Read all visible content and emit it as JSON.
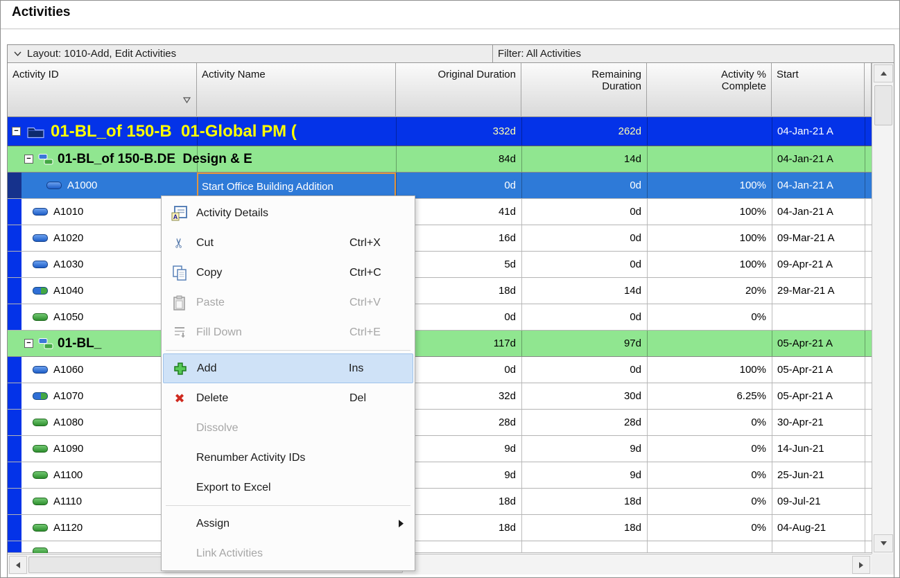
{
  "page": {
    "title": "Activities"
  },
  "toolbar": {
    "layout_label": "Layout: 1010-Add, Edit Activities",
    "filter_label": "Filter: All Activities"
  },
  "table": {
    "columns": [
      "Activity ID",
      "Activity Name",
      "Original Duration",
      "Remaining Duration",
      "Activity % Complete",
      "Start"
    ],
    "rows": [
      {
        "type": "wbs1",
        "name": "01-BL_of 150-B  01-Global PM (",
        "od": "332d",
        "rd": "262d",
        "pct": "",
        "start": "04-Jan-21 A"
      },
      {
        "type": "wbs2",
        "name": "01-BL_of 150-B.DE  Design & E",
        "od": "84d",
        "rd": "14d",
        "pct": "",
        "start": "04-Jan-21 A"
      },
      {
        "type": "activity",
        "selected": true,
        "status": "completed",
        "id": "A1000",
        "name": "Start Office Building Addition",
        "od": "0d",
        "rd": "0d",
        "pct": "100%",
        "start": "04-Jan-21 A"
      },
      {
        "type": "activity",
        "status": "completed",
        "id": "A1010",
        "od": "41d",
        "rd": "0d",
        "pct": "100%",
        "start": "04-Jan-21 A"
      },
      {
        "type": "activity",
        "status": "completed",
        "id": "A1020",
        "od": "16d",
        "rd": "0d",
        "pct": "100%",
        "start": "09-Mar-21 A"
      },
      {
        "type": "activity",
        "status": "completed",
        "id": "A1030",
        "od": "5d",
        "rd": "0d",
        "pct": "100%",
        "start": "09-Apr-21 A"
      },
      {
        "type": "activity",
        "status": "in-progress",
        "id": "A1040",
        "od": "18d",
        "rd": "14d",
        "pct": "20%",
        "start": "29-Mar-21 A"
      },
      {
        "type": "activity",
        "status": "not-started",
        "id": "A1050",
        "od": "0d",
        "rd": "0d",
        "pct": "0%",
        "start": ""
      },
      {
        "type": "wbs2",
        "name": "01-BL_",
        "od": "117d",
        "rd": "97d",
        "pct": "",
        "start": "05-Apr-21 A"
      },
      {
        "type": "activity",
        "status": "completed",
        "id": "A1060",
        "od": "0d",
        "rd": "0d",
        "pct": "100%",
        "start": "05-Apr-21 A"
      },
      {
        "type": "activity",
        "status": "in-progress",
        "id": "A1070",
        "od": "32d",
        "rd": "30d",
        "pct": "6.25%",
        "start": "05-Apr-21 A"
      },
      {
        "type": "activity",
        "status": "not-started",
        "id": "A1080",
        "od": "28d",
        "rd": "28d",
        "pct": "0%",
        "start": "30-Apr-21"
      },
      {
        "type": "activity",
        "status": "not-started",
        "id": "A1090",
        "od": "9d",
        "rd": "9d",
        "pct": "0%",
        "start": "14-Jun-21"
      },
      {
        "type": "activity",
        "status": "not-started",
        "id": "A1100",
        "od": "9d",
        "rd": "9d",
        "pct": "0%",
        "start": "25-Jun-21"
      },
      {
        "type": "activity",
        "status": "not-started",
        "id": "A1110",
        "od": "18d",
        "rd": "18d",
        "pct": "0%",
        "start": "09-Jul-21"
      },
      {
        "type": "activity",
        "status": "not-started",
        "id": "A1120",
        "od": "18d",
        "rd": "18d",
        "pct": "0%",
        "start": "04-Aug-21"
      },
      {
        "type": "partial"
      }
    ]
  },
  "context_menu": {
    "items": [
      {
        "label": "Activity Details",
        "icon": "activity-details-icon"
      },
      {
        "label": "Cut",
        "icon": "cut-icon",
        "shortcut": "Ctrl+X"
      },
      {
        "label": "Copy",
        "icon": "copy-icon",
        "shortcut": "Ctrl+C"
      },
      {
        "label": "Paste",
        "icon": "paste-icon",
        "shortcut": "Ctrl+V",
        "disabled": true
      },
      {
        "label": "Fill Down",
        "icon": "fill-down-icon",
        "shortcut": "Ctrl+E",
        "disabled": true
      },
      {
        "separator": true
      },
      {
        "label": "Add",
        "icon": "add-icon",
        "shortcut": "Ins",
        "highlighted": true
      },
      {
        "label": "Delete",
        "icon": "delete-icon",
        "shortcut": "Del"
      },
      {
        "label": "Dissolve",
        "disabled": true
      },
      {
        "label": "Renumber Activity IDs"
      },
      {
        "label": "Export to Excel"
      },
      {
        "separator": true
      },
      {
        "label": "Assign",
        "submenu": true
      },
      {
        "label": "Link Activities",
        "disabled": true
      }
    ]
  },
  "colors": {
    "wbs_level1_bg": "#0433e8",
    "wbs_level1_text": "#ffff00",
    "wbs_level1_values": "#ffffb0",
    "wbs_level1_date": "#ffffff",
    "wbs_level2_bg": "#90e690",
    "selected_row_bg": "#2e7ad8",
    "selected_row_band": "#16328c",
    "selected_row_text": "#ffffff",
    "focus_cell_border": "#e2953e",
    "menu_highlight_bg": "#cfe2f7",
    "status_completed": "#1e5ec8",
    "status_in_progress": "#2f6fd6",
    "status_not_started": "#2e8f2e"
  }
}
